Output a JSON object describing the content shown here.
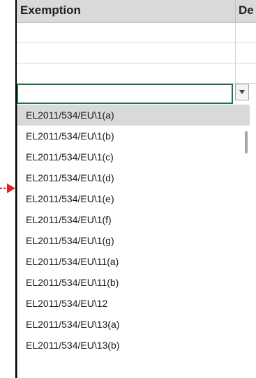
{
  "header": {
    "column_a": "Exemption",
    "column_b": "De"
  },
  "dropdown": {
    "items": [
      "EL2011/534/EU\\1(a)",
      "EL2011/534/EU\\1(b)",
      "EL2011/534/EU\\1(c)",
      "EL2011/534/EU\\1(d)",
      "EL2011/534/EU\\1(e)",
      "EL2011/534/EU\\1(f)",
      "EL2011/534/EU\\1(g)",
      "EL2011/534/EU\\11(a)",
      "EL2011/534/EU\\11(b)",
      "EL2011/534/EU\\12",
      "EL2011/534/EU\\13(a)",
      "EL2011/534/EU\\13(b)"
    ]
  },
  "colors": {
    "accent_green": "#217346",
    "highlight": "#d9d9d9",
    "pointer_red": "#e02020"
  },
  "icons": {
    "dropdown": "chevron-down-icon",
    "pointer": "arrow-right-icon"
  }
}
